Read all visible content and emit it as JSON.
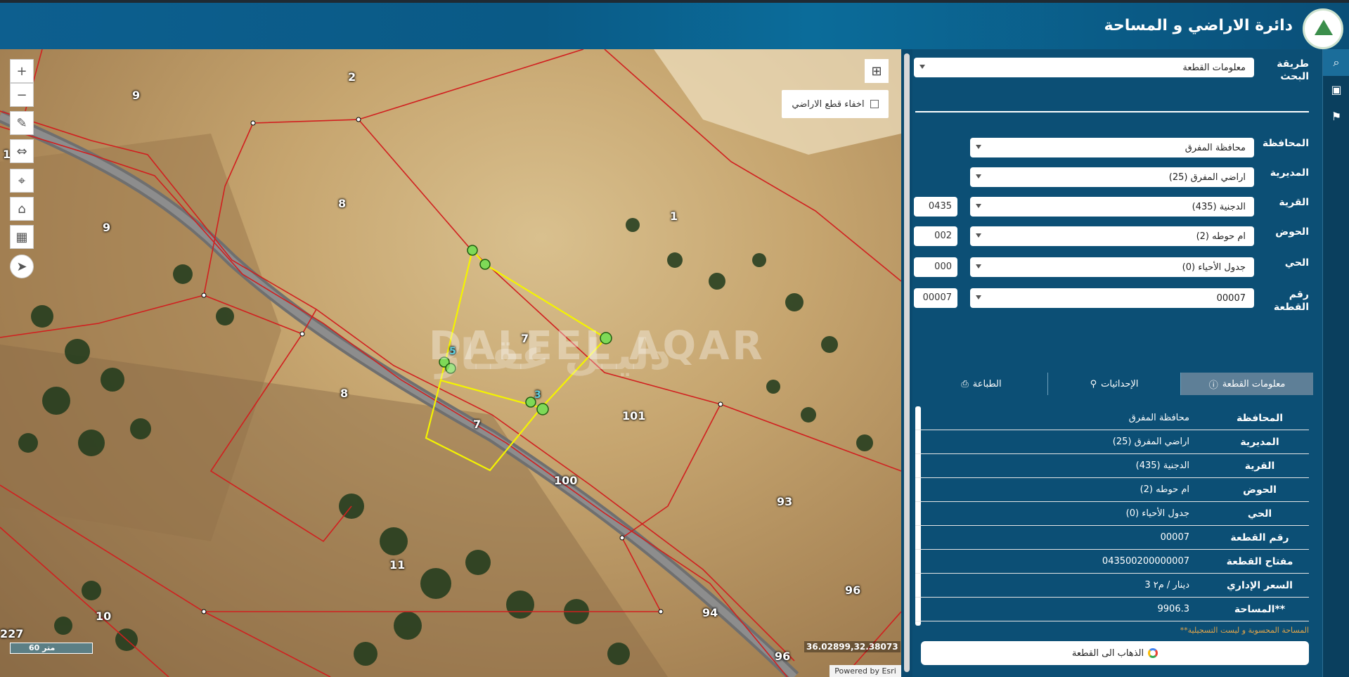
{
  "header": {
    "title": "دائرة الاراضي و المساحة"
  },
  "map": {
    "hide_parcels_label": "اخفاء قطع الاراضي",
    "scale_label": "60 متر",
    "coordinates": "36.02899,32.38073",
    "attribution": "Powered by Esri",
    "watermark": "DALEEL AQAR",
    "watermark_ar": "دليـل عقـار",
    "tools": [
      "zoom-in-icon",
      "zoom-out-icon",
      "pencil-icon",
      "measure-icon",
      "locate-icon",
      "home-icon",
      "basemap-icon",
      "compass-icon"
    ],
    "parcel_labels": [
      "9",
      "2",
      "9",
      "8",
      "1",
      "7",
      "8",
      "7",
      "101",
      "100",
      "93",
      "11",
      "10",
      "94",
      "96",
      "96",
      "227",
      "1"
    ],
    "vertex_labels": [
      "5",
      "3"
    ]
  },
  "search": {
    "method_label": "طريقة البحث",
    "method_value": "معلومات القطعة",
    "fields": [
      {
        "label": "المحافظة",
        "value": "محافظة المفرق",
        "code": ""
      },
      {
        "label": "المديرية",
        "value": "اراضي المفرق (25)",
        "code": ""
      },
      {
        "label": "القرية",
        "value": "الدجنية (435)",
        "code": "0435"
      },
      {
        "label": "الحوض",
        "value": "ام حوطه (2)",
        "code": "002"
      },
      {
        "label": "الحي",
        "value": "جدول الأحياء (0)",
        "code": "000"
      },
      {
        "label": "رقم القطعة",
        "value": "00007",
        "code": "00007"
      }
    ]
  },
  "tabs": [
    {
      "label": "معلومات القطعة",
      "icon": "info-icon",
      "active": true
    },
    {
      "label": "الإحداثيات",
      "icon": "user-pin-icon",
      "active": false
    },
    {
      "label": "الطباعة",
      "icon": "printer-icon",
      "active": false
    }
  ],
  "info": [
    {
      "k": "المحافظة",
      "v": "محافظة المفرق"
    },
    {
      "k": "المديرية",
      "v": "اراضي المفرق (25)"
    },
    {
      "k": "القرية",
      "v": "الدجنية (435)"
    },
    {
      "k": "الحوض",
      "v": "ام حوطه (2)"
    },
    {
      "k": "الحي",
      "v": "جدول الأحياء (0)"
    },
    {
      "k": "رقم القطعة",
      "v": "00007"
    },
    {
      "k": "مفتاح القطعة",
      "v": "043500200000007"
    },
    {
      "k": "السعر الإداري",
      "v": "3 دينار / م٢"
    },
    {
      "k": "المساحة**",
      "v": "9906.3"
    }
  ],
  "note": "**المساحة المحسوبة و ليست التسجيلية",
  "goto_label": "الذهاب الى القطعة",
  "sidebar_icons": [
    "search-icon",
    "layers-icon",
    "location-pin-icon"
  ]
}
